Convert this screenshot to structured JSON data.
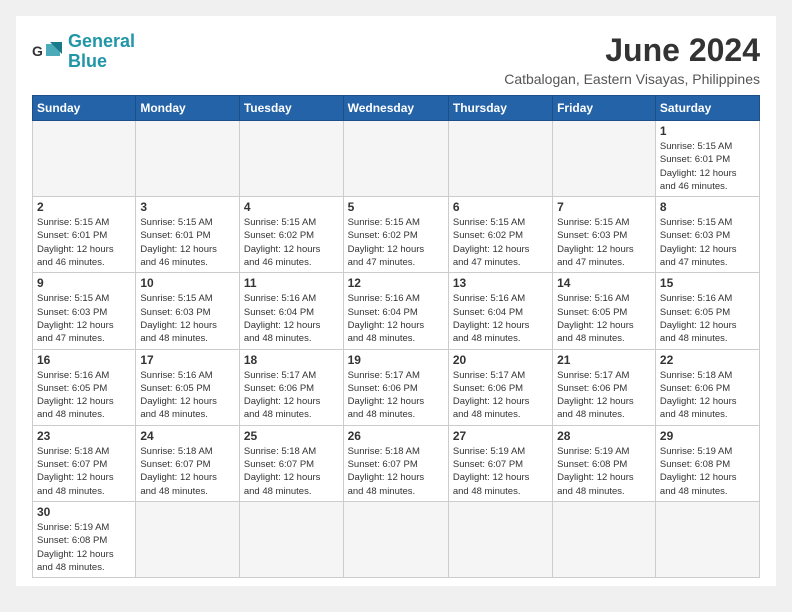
{
  "header": {
    "logo_general": "General",
    "logo_blue": "Blue",
    "month_title": "June 2024",
    "location": "Catbalogan, Eastern Visayas, Philippines"
  },
  "days_of_week": [
    "Sunday",
    "Monday",
    "Tuesday",
    "Wednesday",
    "Thursday",
    "Friday",
    "Saturday"
  ],
  "weeks": [
    [
      {
        "day": null,
        "info": null
      },
      {
        "day": null,
        "info": null
      },
      {
        "day": null,
        "info": null
      },
      {
        "day": null,
        "info": null
      },
      {
        "day": null,
        "info": null
      },
      {
        "day": null,
        "info": null
      },
      {
        "day": "1",
        "info": "Sunrise: 5:15 AM\nSunset: 6:01 PM\nDaylight: 12 hours\nand 46 minutes."
      }
    ],
    [
      {
        "day": "2",
        "info": "Sunrise: 5:15 AM\nSunset: 6:01 PM\nDaylight: 12 hours\nand 46 minutes."
      },
      {
        "day": "3",
        "info": "Sunrise: 5:15 AM\nSunset: 6:01 PM\nDaylight: 12 hours\nand 46 minutes."
      },
      {
        "day": "4",
        "info": "Sunrise: 5:15 AM\nSunset: 6:02 PM\nDaylight: 12 hours\nand 46 minutes."
      },
      {
        "day": "5",
        "info": "Sunrise: 5:15 AM\nSunset: 6:02 PM\nDaylight: 12 hours\nand 47 minutes."
      },
      {
        "day": "6",
        "info": "Sunrise: 5:15 AM\nSunset: 6:02 PM\nDaylight: 12 hours\nand 47 minutes."
      },
      {
        "day": "7",
        "info": "Sunrise: 5:15 AM\nSunset: 6:03 PM\nDaylight: 12 hours\nand 47 minutes."
      },
      {
        "day": "8",
        "info": "Sunrise: 5:15 AM\nSunset: 6:03 PM\nDaylight: 12 hours\nand 47 minutes."
      }
    ],
    [
      {
        "day": "9",
        "info": "Sunrise: 5:15 AM\nSunset: 6:03 PM\nDaylight: 12 hours\nand 47 minutes."
      },
      {
        "day": "10",
        "info": "Sunrise: 5:15 AM\nSunset: 6:03 PM\nDaylight: 12 hours\nand 48 minutes."
      },
      {
        "day": "11",
        "info": "Sunrise: 5:16 AM\nSunset: 6:04 PM\nDaylight: 12 hours\nand 48 minutes."
      },
      {
        "day": "12",
        "info": "Sunrise: 5:16 AM\nSunset: 6:04 PM\nDaylight: 12 hours\nand 48 minutes."
      },
      {
        "day": "13",
        "info": "Sunrise: 5:16 AM\nSunset: 6:04 PM\nDaylight: 12 hours\nand 48 minutes."
      },
      {
        "day": "14",
        "info": "Sunrise: 5:16 AM\nSunset: 6:05 PM\nDaylight: 12 hours\nand 48 minutes."
      },
      {
        "day": "15",
        "info": "Sunrise: 5:16 AM\nSunset: 6:05 PM\nDaylight: 12 hours\nand 48 minutes."
      }
    ],
    [
      {
        "day": "16",
        "info": "Sunrise: 5:16 AM\nSunset: 6:05 PM\nDaylight: 12 hours\nand 48 minutes."
      },
      {
        "day": "17",
        "info": "Sunrise: 5:16 AM\nSunset: 6:05 PM\nDaylight: 12 hours\nand 48 minutes."
      },
      {
        "day": "18",
        "info": "Sunrise: 5:17 AM\nSunset: 6:06 PM\nDaylight: 12 hours\nand 48 minutes."
      },
      {
        "day": "19",
        "info": "Sunrise: 5:17 AM\nSunset: 6:06 PM\nDaylight: 12 hours\nand 48 minutes."
      },
      {
        "day": "20",
        "info": "Sunrise: 5:17 AM\nSunset: 6:06 PM\nDaylight: 12 hours\nand 48 minutes."
      },
      {
        "day": "21",
        "info": "Sunrise: 5:17 AM\nSunset: 6:06 PM\nDaylight: 12 hours\nand 48 minutes."
      },
      {
        "day": "22",
        "info": "Sunrise: 5:18 AM\nSunset: 6:06 PM\nDaylight: 12 hours\nand 48 minutes."
      }
    ],
    [
      {
        "day": "23",
        "info": "Sunrise: 5:18 AM\nSunset: 6:07 PM\nDaylight: 12 hours\nand 48 minutes."
      },
      {
        "day": "24",
        "info": "Sunrise: 5:18 AM\nSunset: 6:07 PM\nDaylight: 12 hours\nand 48 minutes."
      },
      {
        "day": "25",
        "info": "Sunrise: 5:18 AM\nSunset: 6:07 PM\nDaylight: 12 hours\nand 48 minutes."
      },
      {
        "day": "26",
        "info": "Sunrise: 5:18 AM\nSunset: 6:07 PM\nDaylight: 12 hours\nand 48 minutes."
      },
      {
        "day": "27",
        "info": "Sunrise: 5:19 AM\nSunset: 6:07 PM\nDaylight: 12 hours\nand 48 minutes."
      },
      {
        "day": "28",
        "info": "Sunrise: 5:19 AM\nSunset: 6:08 PM\nDaylight: 12 hours\nand 48 minutes."
      },
      {
        "day": "29",
        "info": "Sunrise: 5:19 AM\nSunset: 6:08 PM\nDaylight: 12 hours\nand 48 minutes."
      }
    ],
    [
      {
        "day": "30",
        "info": "Sunrise: 5:19 AM\nSunset: 6:08 PM\nDaylight: 12 hours\nand 48 minutes."
      },
      {
        "day": null,
        "info": null
      },
      {
        "day": null,
        "info": null
      },
      {
        "day": null,
        "info": null
      },
      {
        "day": null,
        "info": null
      },
      {
        "day": null,
        "info": null
      },
      {
        "day": null,
        "info": null
      }
    ]
  ]
}
